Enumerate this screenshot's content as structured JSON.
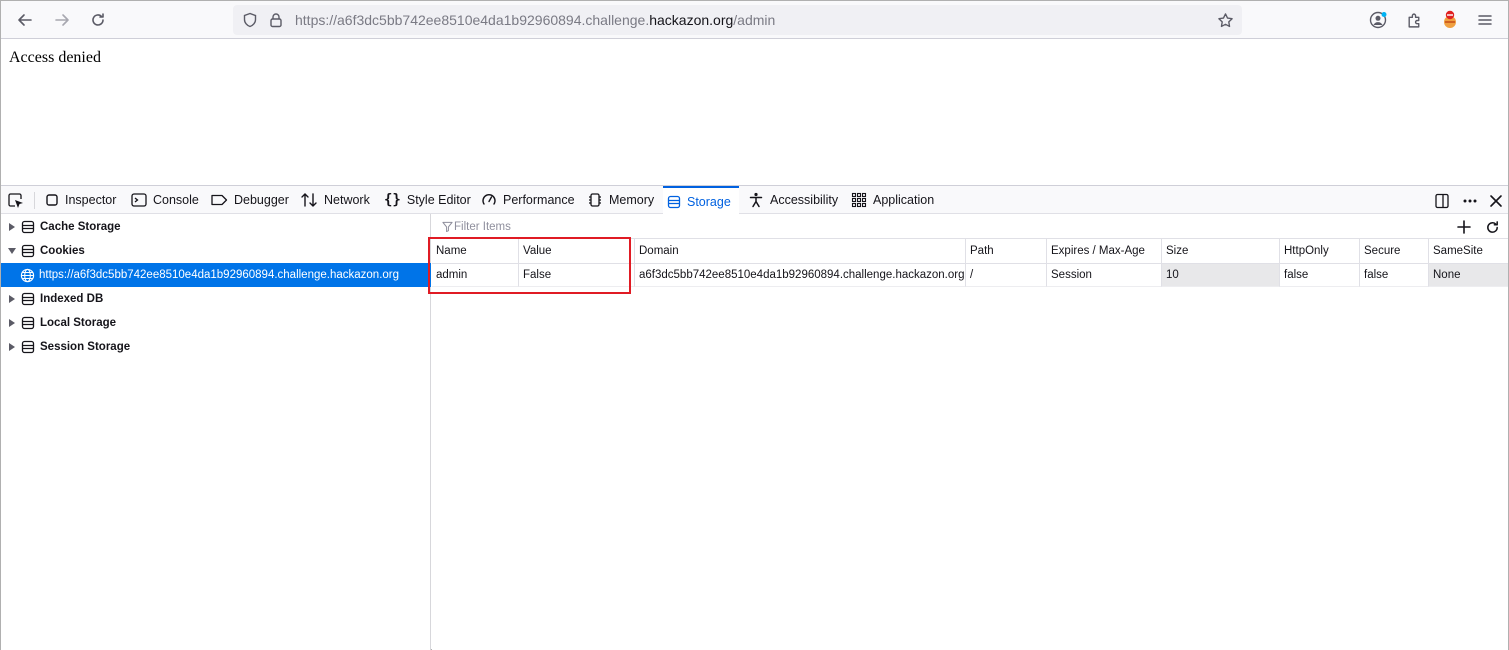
{
  "browser": {
    "url_prefix": "https://a6f3dc5bb742ee8510e4da1b92960894.challenge.",
    "url_host": "hackazon.org",
    "url_path": "/admin"
  },
  "page": {
    "message": "Access denied"
  },
  "devtools": {
    "tabs": [
      {
        "label": "Inspector",
        "icon": "inspector-icon"
      },
      {
        "label": "Console",
        "icon": "console-icon"
      },
      {
        "label": "Debugger",
        "icon": "debugger-icon"
      },
      {
        "label": "Network",
        "icon": "network-icon"
      },
      {
        "label": "Style Editor",
        "icon": "style-editor-icon"
      },
      {
        "label": "Performance",
        "icon": "performance-icon"
      },
      {
        "label": "Memory",
        "icon": "memory-icon"
      },
      {
        "label": "Storage",
        "icon": "storage-icon",
        "active": true
      },
      {
        "label": "Accessibility",
        "icon": "accessibility-icon"
      },
      {
        "label": "Application",
        "icon": "application-icon"
      }
    ],
    "accent_color": "#0061e0"
  },
  "sidebar": {
    "items": [
      {
        "label": "Cache Storage",
        "expanded": false
      },
      {
        "label": "Cookies",
        "expanded": true
      },
      {
        "label": "https://a6f3dc5bb742ee8510e4da1b92960894.challenge.hackazon.org",
        "selected": true
      },
      {
        "label": "Indexed DB",
        "expanded": false
      },
      {
        "label": "Local Storage",
        "expanded": false
      },
      {
        "label": "Session Storage",
        "expanded": false
      }
    ]
  },
  "table": {
    "filter_placeholder": "Filter Items",
    "columns": [
      "Name",
      "Value",
      "Domain",
      "Path",
      "Expires / Max-Age",
      "Size",
      "HttpOnly",
      "Secure",
      "SameSite"
    ],
    "rows": [
      [
        "admin",
        "False",
        "a6f3dc5bb742ee8510e4da1b92960894.challenge.hackazon.org",
        "/",
        "Session",
        "10",
        "false",
        "false",
        "None"
      ]
    ]
  }
}
